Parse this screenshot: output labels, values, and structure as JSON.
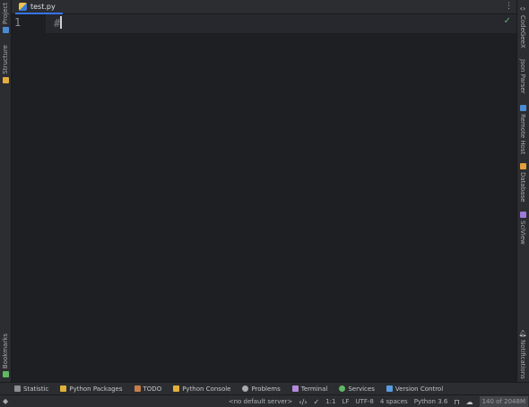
{
  "editor": {
    "tab": {
      "filename": "test.py"
    },
    "line_number": "1",
    "code_line": "#"
  },
  "left_strip": {
    "project_label": "Project",
    "structure_label": "Structure",
    "bookmarks_label": "Bookmarks"
  },
  "right_strip": {
    "codegeex_label": "CodeGeeX",
    "json_parser_label": "Json Parser",
    "remote_host_label": "Remote Host",
    "database_label": "Database",
    "sciview_label": "SciView",
    "notifications_label": "Notifications"
  },
  "tool_windows": [
    {
      "label": "Statistic",
      "icon": "statistic-icon",
      "color": "#8a8d92"
    },
    {
      "label": "Python Packages",
      "icon": "python-packages-icon",
      "color": "#e0b03c"
    },
    {
      "label": "TODO",
      "icon": "todo-icon",
      "color": "#c87d4e"
    },
    {
      "label": "Python Console",
      "icon": "python-console-icon",
      "color": "#e0b03c"
    },
    {
      "label": "Problems",
      "icon": "problems-icon",
      "color": "#a9abb0"
    },
    {
      "label": "Terminal",
      "icon": "terminal-icon",
      "color": "#b58ad8"
    },
    {
      "label": "Services",
      "icon": "services-icon",
      "color": "#5fb865"
    },
    {
      "label": "Version Control",
      "icon": "version-control-icon",
      "color": "#5a9be0"
    }
  ],
  "status_bar": {
    "server": "<no default server>",
    "position": "1:1",
    "line_separator": "LF",
    "encoding": "UTF-8",
    "indent": "4 spaces",
    "interpreter": "Python 3.6",
    "memory": "140 of 2048M"
  },
  "colors": {
    "accent": "#3574f0",
    "background": "#1e1f22",
    "panel": "#2b2d30"
  }
}
